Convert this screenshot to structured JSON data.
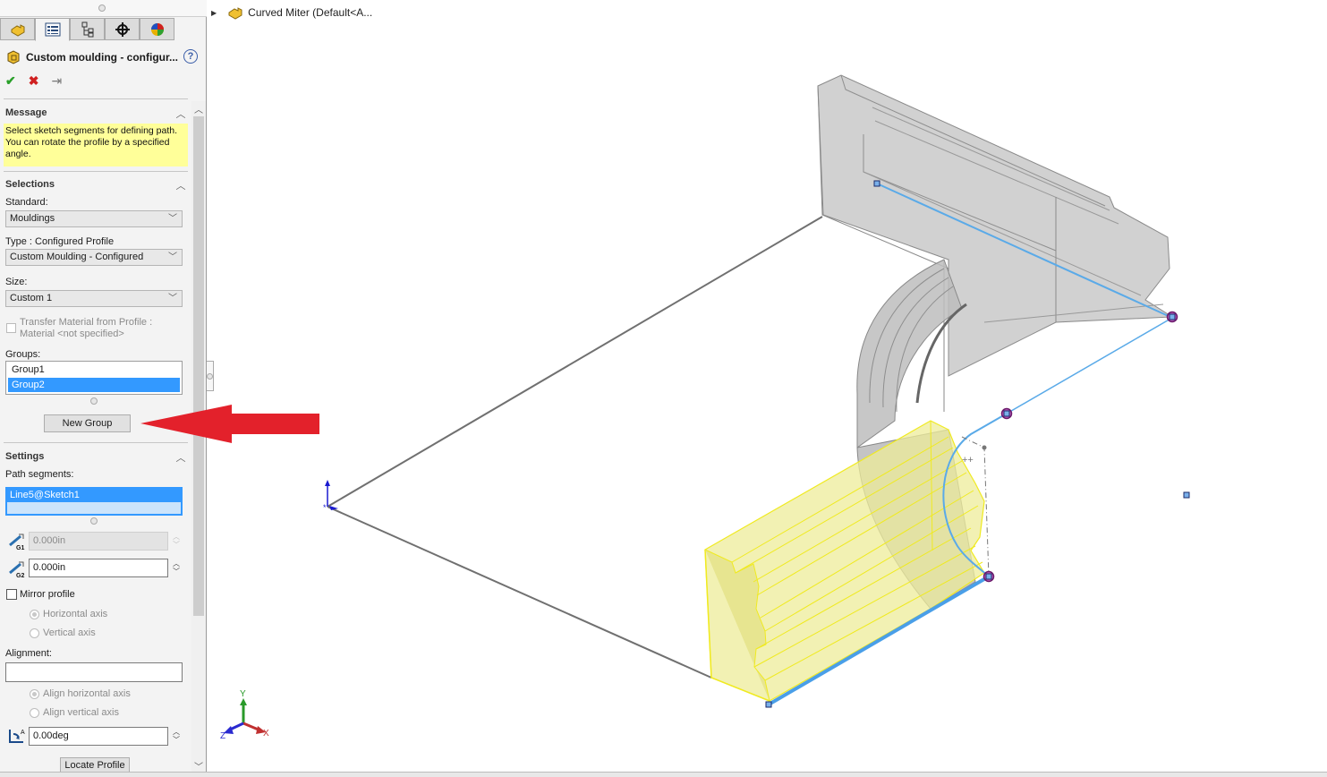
{
  "property_manager": {
    "tabs": [
      {
        "name": "feature-manager",
        "icon": "part-icon"
      },
      {
        "name": "property-manager",
        "icon": "property-manager-icon",
        "active": true
      },
      {
        "name": "configuration-manager",
        "icon": "configuration-icon"
      },
      {
        "name": "dimxpert-manager",
        "icon": "crosshair-icon"
      },
      {
        "name": "display-manager",
        "icon": "appearance-icon"
      }
    ],
    "title": "Custom moulding - configur...",
    "help_label": "?",
    "actions": {
      "ok": "✔",
      "cancel": "✖",
      "pin": "⇥"
    },
    "message": {
      "header": "Message",
      "text": "Select sketch segments for defining path. You can rotate the profile by a specified angle."
    },
    "selections": {
      "header": "Selections",
      "standard_label": "Standard:",
      "standard_value": "Mouldings",
      "type_label": "Type : Configured Profile",
      "type_value": "Custom Moulding - Configured",
      "size_label": "Size:",
      "size_value": "Custom 1",
      "transfer_material_label": "Transfer Material from Profile : Material <not specified>",
      "transfer_material_checked": false,
      "groups_label": "Groups:",
      "groups": [
        {
          "label": "Group1",
          "selected": false
        },
        {
          "label": "Group2",
          "selected": true
        }
      ],
      "new_group_label": "New Group"
    },
    "settings": {
      "header": "Settings",
      "path_segments_label": "Path segments:",
      "path_segments": [
        "Line5@Sketch1"
      ],
      "gap1_value": "0.000in",
      "gap1_icon_label": "G1",
      "gap2_value": "0.000in",
      "gap2_icon_label": "G2",
      "mirror_profile_label": "Mirror profile",
      "mirror_profile_checked": false,
      "horizontal_axis_label": "Horizontal axis",
      "vertical_axis_label": "Vertical axis",
      "alignment_label": "Alignment:",
      "alignment_value": "",
      "align_horizontal_label": "Align horizontal axis",
      "align_vertical_label": "Align vertical axis",
      "rotation_angle_value": "0.00deg",
      "locate_profile_label": "Locate Profile"
    }
  },
  "graphics_area": {
    "feature_tree_root": "Curved Miter  (Default<A...",
    "triad": {
      "x": "X",
      "y": "Y",
      "z": "Z"
    },
    "colors": {
      "path_highlight": "#4a9fe8",
      "preview_yellow": "#f5f06a",
      "endpoint_magenta": "#9a2a9a",
      "annotation_arrow": "#e3212b"
    }
  }
}
